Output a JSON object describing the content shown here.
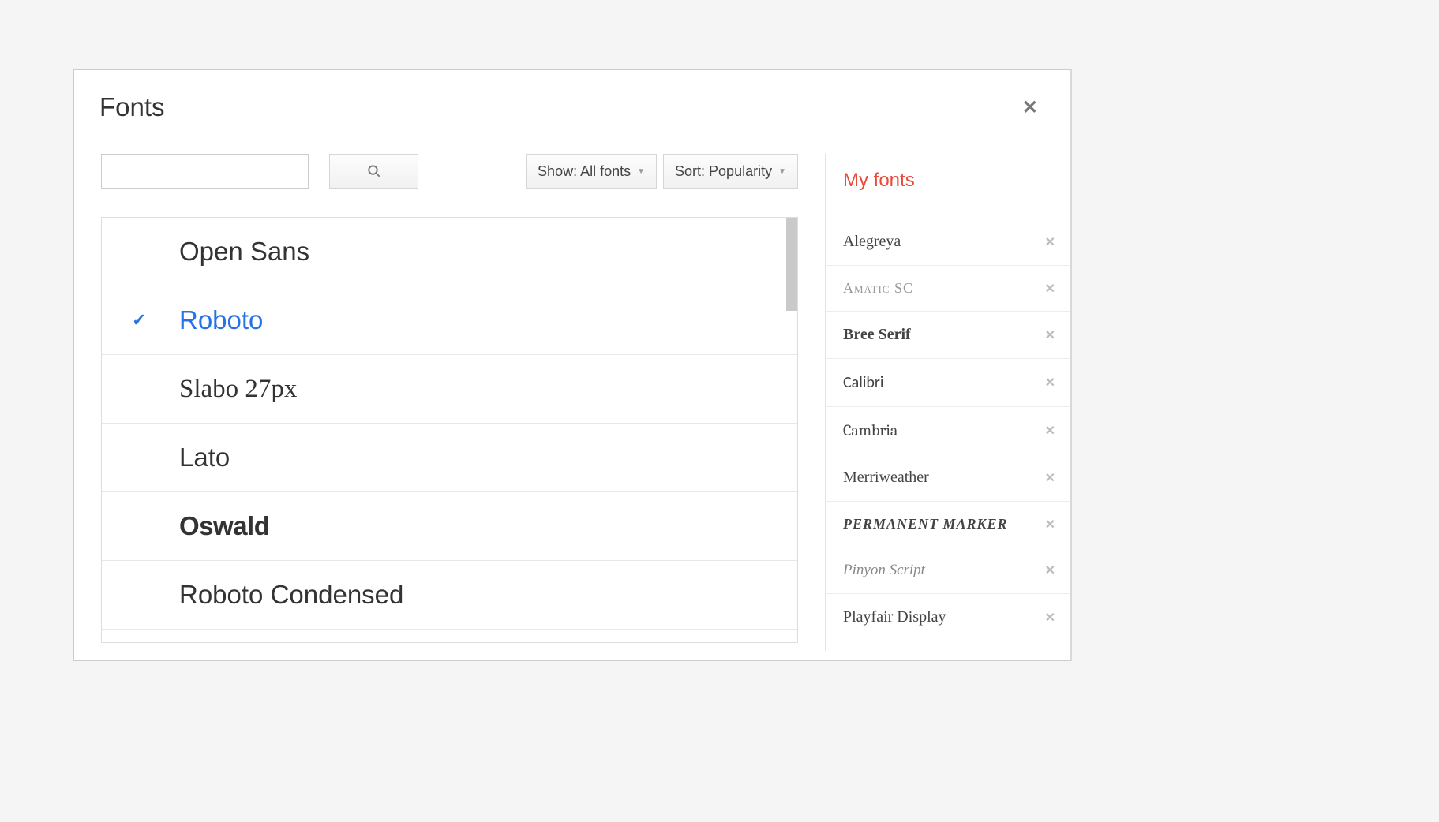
{
  "modal": {
    "title": "Fonts"
  },
  "controls": {
    "show_label": "Show: All fonts",
    "sort_label": "Sort: Popularity",
    "search_value": ""
  },
  "font_list": [
    {
      "name": "Open Sans",
      "selected": false,
      "css": "font-opensans"
    },
    {
      "name": "Roboto",
      "selected": true,
      "css": "selected"
    },
    {
      "name": "Slabo 27px",
      "selected": false,
      "css": "font-slabo"
    },
    {
      "name": "Lato",
      "selected": false,
      "css": "font-lato"
    },
    {
      "name": "Oswald",
      "selected": false,
      "css": "font-oswald"
    },
    {
      "name": "Roboto Condensed",
      "selected": false,
      "css": "font-robotocond"
    }
  ],
  "my_fonts": {
    "title": "My fonts",
    "items": [
      {
        "name": "Alegreya",
        "css": "mf-alegreya"
      },
      {
        "name": "Amatic SC",
        "css": "mf-amatic"
      },
      {
        "name": "Bree Serif",
        "css": "mf-bree"
      },
      {
        "name": "Calibri",
        "css": "mf-calibri"
      },
      {
        "name": "Cambria",
        "css": "mf-cambria"
      },
      {
        "name": "Merriweather",
        "css": "mf-merriweather"
      },
      {
        "name": "Permanent Marker",
        "css": "mf-permanent"
      },
      {
        "name": "Pinyon Script",
        "css": "mf-pinyon"
      },
      {
        "name": "Playfair Display",
        "css": "mf-playfair"
      }
    ]
  }
}
